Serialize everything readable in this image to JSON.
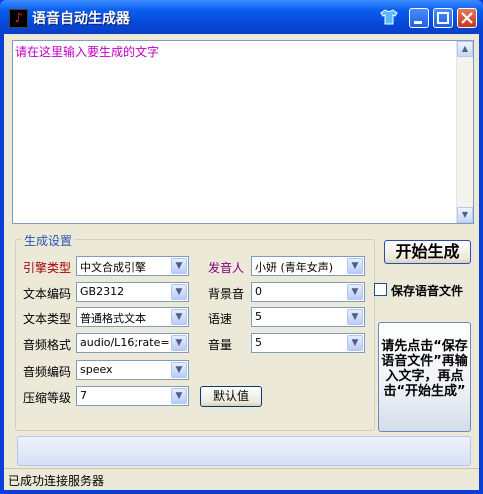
{
  "window": {
    "title": "语音自动生成器"
  },
  "editor": {
    "text": "请在这里输入要生成的文字"
  },
  "settings": {
    "group_title": "生成设置",
    "engine_type": {
      "label": "引擎类型",
      "value": "中文合成引擎"
    },
    "text_encoding": {
      "label": "文本编码",
      "value": "GB2312"
    },
    "text_type": {
      "label": "文本类型",
      "value": "普通格式文本"
    },
    "audio_format": {
      "label": "音频格式",
      "value": "audio/L16;rate="
    },
    "audio_encoding": {
      "label": "音频编码",
      "value": "speex"
    },
    "compression_level": {
      "label": "压缩等级",
      "value": "7"
    },
    "speaker": {
      "label": "发音人",
      "value": "小妍 (青年女声)"
    },
    "background_sound": {
      "label": "背景音",
      "value": "0"
    },
    "speed": {
      "label": "语速",
      "value": "5"
    },
    "volume": {
      "label": "音量",
      "value": "5"
    },
    "default_button": "默认值"
  },
  "actions": {
    "start_button": "开始生成",
    "save_audio_checkbox": "保存语音文件",
    "info_button": "请先点击“保存语音文件”再输入文字，再点击“开始生成”"
  },
  "status": {
    "text": "已成功连接服务器"
  }
}
